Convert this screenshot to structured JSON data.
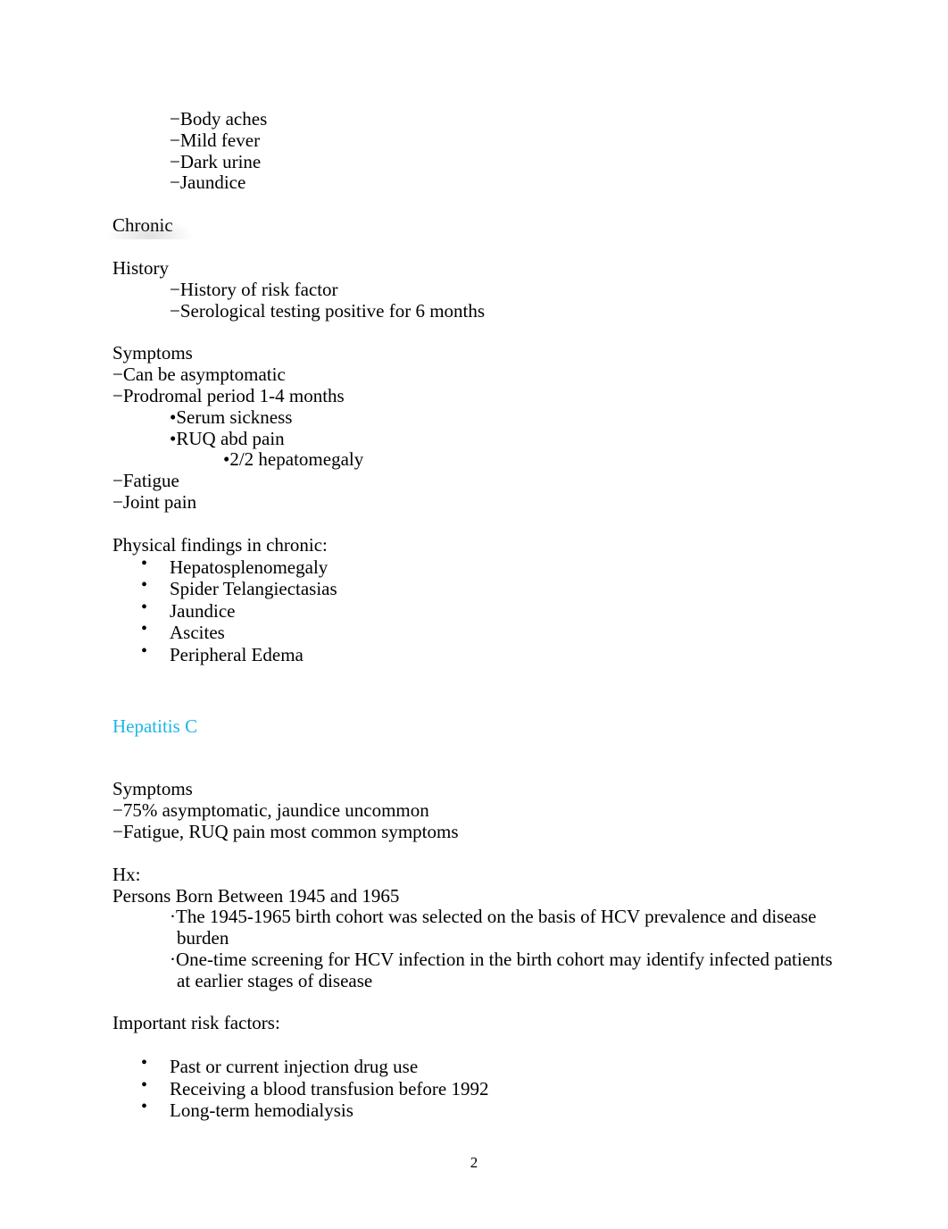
{
  "document": {
    "page_number": "2",
    "accent_color": "#1DB5E8",
    "text_color": "#000000",
    "background_color": "#FFFFFF"
  },
  "acute_symptoms_tail": {
    "items": [
      "−Body aches",
      "−Mild fever",
      "−Dark urine",
      "−Jaundice"
    ]
  },
  "chronic": {
    "heading": "Chronic",
    "history": {
      "label": "History",
      "items": [
        "−History of risk factor",
        "−Serological testing positive for 6 months"
      ]
    },
    "symptoms": {
      "label": "Symptoms",
      "items": [
        "−Can be asymptomatic",
        "−Prodromal period 1-4 months"
      ],
      "sub_items": [
        "•Serum sickness",
        "•RUQ abd pain"
      ],
      "sub_sub_items": [
        "•2/2 hepatomegaly"
      ],
      "items_after": [
        "−Fatigue",
        "−Joint pain"
      ]
    },
    "physical_findings": {
      "label": "Physical findings in chronic:",
      "bullet": "•",
      "items": [
        "Hepatosplenomegaly",
        "Spider Telangiectasias",
        "Jaundice",
        "Ascites",
        "Peripheral Edema"
      ]
    }
  },
  "hepatitis_c": {
    "heading": "Hepatitis C",
    "symptoms": {
      "label": "Symptoms",
      "items": [
        "−75% asymptomatic, jaundice uncommon",
        "−Fatigue, RUQ pain most common symptoms"
      ]
    },
    "hx": {
      "label": "Hx:",
      "subheading": "Persons Born Between 1945 and 1965",
      "notes": [
        "·The 1945-1965 birth cohort was selected on the basis of HCV prevalence and disease burden",
        "·One-time screening for HCV infection in the birth cohort may identify infected patients at earlier stages of disease"
      ]
    },
    "risk_factors": {
      "label": "Important risk factors:",
      "bullet": "•",
      "items": [
        "Past or current injection drug use",
        "Receiving a blood transfusion before 1992",
        "Long-term hemodialysis"
      ]
    }
  }
}
